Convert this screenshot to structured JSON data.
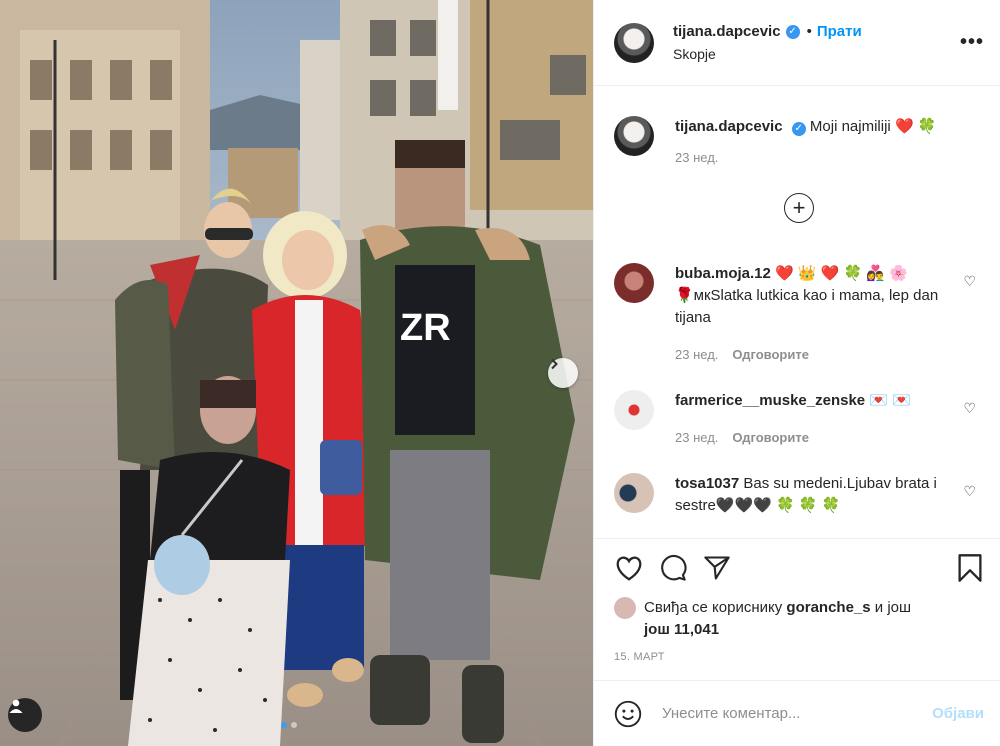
{
  "header": {
    "username": "tijana.dapcevic",
    "follow_label": "Прати",
    "location": "Skopje",
    "separator": "•",
    "more_label": "•••"
  },
  "caption": {
    "username": "tijana.dapcevic",
    "text": "Moji najmiliji",
    "emojis": "❤️ 🍀",
    "time": "23 нед."
  },
  "load_more_label": "+",
  "comments": [
    {
      "username": "buba.moja.12",
      "emojis": "❤️ 👑 ❤️ 🍀 👩‍❤️‍👨 🌸",
      "text": "🌹мкSlatka lutkica kao i mama, lep dan tijana",
      "time": "23 нед.",
      "reply_label": "Одговорите"
    },
    {
      "username": "farmerice__muske_zenske",
      "emojis": "💌 💌",
      "time": "23 нед.",
      "reply_label": "Одговорите"
    },
    {
      "username": "tosa1037",
      "text": "Bas su medeni.Ljubav brata i sestre🖤🖤🖤 🍀 🍀 🍀"
    }
  ],
  "likes": {
    "prefix": "Свиђа се кориснику",
    "user": "goranche_s",
    "middle": "и још",
    "count": "још 11,041"
  },
  "date": "15. МАРТ",
  "comment_input": {
    "placeholder": "Унесите коментар...",
    "post_label": "Објави"
  },
  "icons": [
    "heart-icon",
    "comment-icon",
    "share-icon",
    "bookmark-icon",
    "emoji-icon",
    "user-tag-icon",
    "chevron-right-icon",
    "verified-icon",
    "more-icon"
  ],
  "colors": {
    "accent": "#0095f6",
    "post_disabled": "#b2dffc",
    "secondary_text": "#8e8e8e"
  },
  "carousel": {
    "count": 2,
    "active": 1
  }
}
